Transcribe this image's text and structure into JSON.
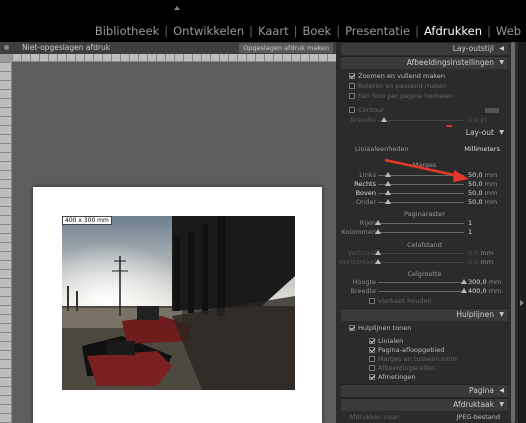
{
  "modules": [
    "Bibliotheek",
    "Ontwikkelen",
    "Kaart",
    "Boek",
    "Presentatie",
    "Afdrukken",
    "Web"
  ],
  "active_module": "Afdrukken",
  "work_area": {
    "title": "Niet-opgeslagen afdruk",
    "save_button": "Opgeslagen afdruk maken"
  },
  "cell_label": "400 x 300 mm",
  "panel": {
    "layout_style_header": "Lay-outstijl",
    "image_settings_header": "Afbeeldingsinstellingen",
    "image_settings": [
      {
        "label": "Zoomen en vullend maken",
        "checked": true
      },
      {
        "label": "Roteren en passend maken",
        "checked": false
      },
      {
        "label": "Eén foto per pagina herhalen",
        "checked": false
      }
    ],
    "contour": {
      "label": "Contour",
      "checked": false
    },
    "contour_width": {
      "label": "Breedte",
      "value": "1,0 pt"
    },
    "step_number": "3",
    "layout_header": "Lay-out",
    "ruler_units": {
      "label": "Liniaaleenheden",
      "value": "Millimeters"
    },
    "margins_title": "Marges",
    "margins": [
      {
        "label": "Links",
        "value": "50,0",
        "unit": "mm",
        "pos": 0.12,
        "highlight": false
      },
      {
        "label": "Rechts",
        "value": "50,0",
        "unit": "mm",
        "pos": 0.12,
        "highlight": true
      },
      {
        "label": "Boven",
        "value": "50,0",
        "unit": "mm",
        "pos": 0.12,
        "highlight": true
      },
      {
        "label": "Onder",
        "value": "50,0",
        "unit": "mm",
        "pos": 0.12,
        "highlight": false
      }
    ],
    "page_grid_title": "Paginaraster",
    "page_grid": [
      {
        "label": "Rijen",
        "value": "1",
        "pos": 0.0
      },
      {
        "label": "Kolommen",
        "value": "1",
        "pos": 0.0
      }
    ],
    "cell_spacing_title": "Celafstand",
    "cell_spacing": [
      {
        "label": "Verticaal",
        "value": "0,0",
        "unit": "mm"
      },
      {
        "label": "Horizontaal",
        "value": "0,0",
        "unit": "mm"
      }
    ],
    "cell_size_title": "Celgrootte",
    "cell_size": [
      {
        "label": "Hoogte",
        "value": "300,0",
        "unit": "mm",
        "pos": 1.0
      },
      {
        "label": "Breedte",
        "value": "400,0",
        "unit": "mm",
        "pos": 1.0
      }
    ],
    "keep_square": {
      "label": "Vierkant houden",
      "checked": false
    },
    "guides_header": "Hulplijnen",
    "show_guides": {
      "label": "Hulplijnen tonen",
      "checked": true
    },
    "guide_options": [
      {
        "label": "Linialen",
        "checked": true
      },
      {
        "label": "Pagina-afloopgebied",
        "checked": true
      },
      {
        "label": "Marges en tussenruimte",
        "checked": false
      },
      {
        "label": "Afbeeldingscellen",
        "checked": false
      },
      {
        "label": "Afmetingen",
        "checked": true
      }
    ],
    "page_header": "Pagina",
    "print_job_header": "Afdruktaak",
    "print_to": {
      "label": "Afdrukken naar:",
      "value": "JPEG-bestand"
    }
  }
}
